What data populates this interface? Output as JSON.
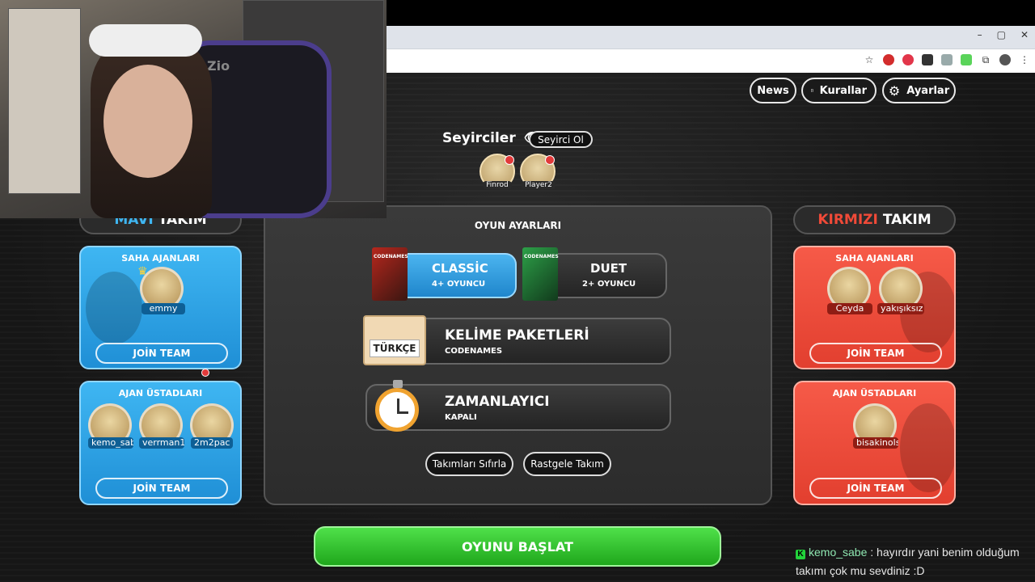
{
  "header": {
    "news_label": "News",
    "rules_label": "Kurallar",
    "settings_label": "Ayarlar"
  },
  "browser": {
    "window_controls": [
      "–",
      "▢",
      "✕"
    ]
  },
  "spectators": {
    "title": "Seyirciler",
    "become_spectator_label": "Seyirci Ol",
    "players": [
      "Finrod",
      "Player2"
    ]
  },
  "blue_team": {
    "title_accent": "MAVİ",
    "title_rest": "TAKIM",
    "accent_color": "#3fb6f2",
    "field_agents": {
      "title": "SAHA AJANLARI",
      "players": [
        "emmy"
      ],
      "join_label": "JOİN TEAM"
    },
    "spymasters": {
      "title": "AJAN ÜSTADLARI",
      "players": [
        "kemo_sabe",
        "verrman1",
        "2m2pac"
      ],
      "join_label": "JOİN TEAM"
    }
  },
  "red_team": {
    "title_accent": "KIRMIZI",
    "title_rest": "TAKIM",
    "accent_color": "#f04a38",
    "field_agents": {
      "title": "SAHA AJANLARI",
      "players": [
        "Ceyda",
        "yakışıksız c"
      ],
      "join_label": "JOİN TEAM"
    },
    "spymasters": {
      "title": "AJAN ÜSTADLARI",
      "players": [
        "bisakinols"
      ],
      "join_label": "JOİN TEAM"
    }
  },
  "game_settings": {
    "title": "OYUN AYARLARI",
    "modes": [
      {
        "title": "CLASSİC",
        "subtitle": "4+ OYUNCU",
        "selected": true
      },
      {
        "title": "DUET",
        "subtitle": "2+ OYUNCU",
        "selected": false
      }
    ],
    "word_packs": {
      "title": "KELİME PAKETLERİ",
      "subtitle": "CODENAMES",
      "card_label": "TÜRKÇE"
    },
    "timer": {
      "title": "ZAMANLAYICI",
      "subtitle": "KAPALI"
    },
    "reset_teams_label": "Takımları Sıfırla",
    "random_teams_label": "Rastgele Takım",
    "box_label": "CODENAMES"
  },
  "start_button_label": "OYUNU BAŞLAT",
  "chat": {
    "badge": "K",
    "user": "kemo_sabe",
    "message": " : hayırdır yani benim olduğum takımı çok mu sevdiniz :D"
  },
  "webcam": {
    "chair_logo": "Zio"
  }
}
